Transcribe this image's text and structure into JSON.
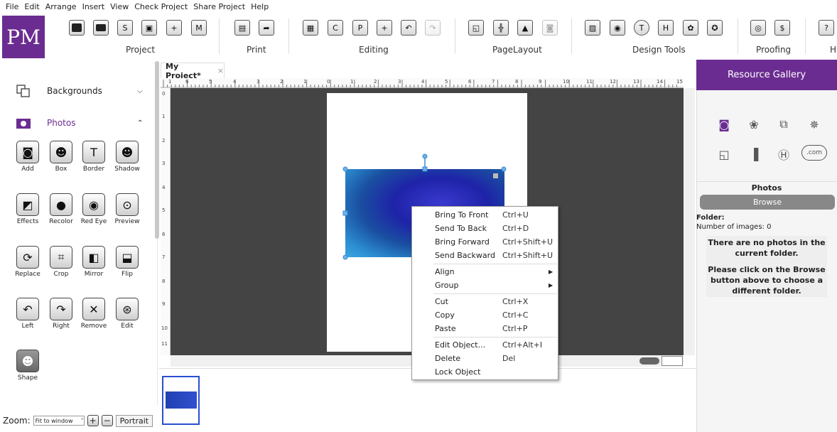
{
  "menubar": [
    "File",
    "Edit",
    "Arrange",
    "Insert",
    "View",
    "Check Project",
    "Share Project",
    "Help"
  ],
  "logo": "PM",
  "toolbar": {
    "groups": {
      "project": "Project",
      "print": "Print",
      "editing": "Editing",
      "pagelayout": "PageLayout",
      "design": "Design Tools",
      "proofing": "Proofing",
      "help": "H"
    }
  },
  "leftpanel": {
    "backgrounds": "Backgrounds",
    "photos": "Photos",
    "tools": {
      "add": "Add",
      "box": "Box",
      "border": "Border",
      "shadow": "Shadow",
      "effects": "Effects",
      "recolor": "Recolor",
      "redeye": "Red Eye",
      "preview": "Preview",
      "replace": "Replace",
      "crop": "Crop",
      "mirror": "Mirror",
      "flip": "Flip",
      "left": "Left",
      "right": "Right",
      "remove": "Remove",
      "edit": "Edit",
      "shape": "Shape"
    }
  },
  "zoom": {
    "label": "Zoom:",
    "value": "Fit to window",
    "orientation": "Portrait"
  },
  "tab": {
    "title": "My Project*",
    "close": "×"
  },
  "ruler": {
    "h": [
      "1",
      "6",
      "5",
      "4",
      "3",
      "2",
      "1",
      "0",
      "1",
      "2",
      "3",
      "4",
      "5",
      "6",
      "7",
      "8",
      "9",
      "10",
      "11",
      "12",
      "13",
      "14",
      "15"
    ],
    "v": [
      "0",
      "1",
      "2",
      "3",
      "4",
      "5",
      "6",
      "7",
      "8",
      "9",
      "10",
      "11"
    ]
  },
  "context_menu": {
    "bring_front": {
      "label": "Bring To Front",
      "shortcut": "Ctrl+U"
    },
    "send_back": {
      "label": "Send To Back",
      "shortcut": "Ctrl+D"
    },
    "bring_fwd": {
      "label": "Bring Forward",
      "shortcut": "Ctrl+Shift+U"
    },
    "send_bwd": {
      "label": "Send Backward",
      "shortcut": "Ctrl+Shift+U"
    },
    "align": {
      "label": "Align"
    },
    "group": {
      "label": "Group"
    },
    "cut": {
      "label": "Cut",
      "shortcut": "Ctrl+X"
    },
    "copy": {
      "label": "Copy",
      "shortcut": "Ctrl+C"
    },
    "paste": {
      "label": "Paste",
      "shortcut": "Ctrl+P"
    },
    "edit_obj": {
      "label": "Edit Object...",
      "shortcut": "Ctrl+Alt+I"
    },
    "delete": {
      "label": "Delete",
      "shortcut": "Del"
    },
    "lock": {
      "label": "Lock Object"
    }
  },
  "rightpanel": {
    "title": "Resource Gallery",
    "photos": "Photos",
    "browse": "Browse",
    "folder": "Folder:",
    "num_images": "Number of images: 0",
    "msg1": "There are no photos in the current folder.",
    "msg2": "Please click on the Browse button above to choose a different folder.",
    "com": ".com"
  },
  "colors": {
    "brand": "#6b2c91",
    "canvas": "#444444",
    "selection": "#3a8ad0"
  }
}
